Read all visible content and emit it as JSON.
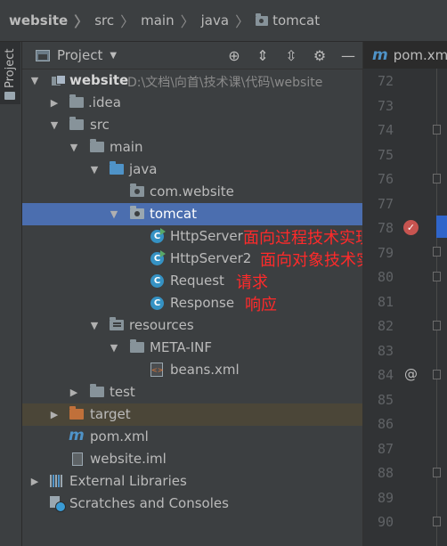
{
  "breadcrumb": {
    "items": [
      "website",
      "src",
      "main",
      "java",
      "tomcat"
    ]
  },
  "tool_strip": {
    "label": "Project"
  },
  "panel": {
    "title": "Project",
    "tools": [
      "target-icon",
      "expand-all-icon",
      "collapse-all-icon",
      "gear-icon",
      "minimize-icon"
    ]
  },
  "tree": {
    "website": {
      "label": "website",
      "path": "D:\\文档\\向首\\技术课\\代码\\website"
    },
    "idea": "idea",
    "src": "src",
    "main": "main",
    "java": "java",
    "com_website": "com.website",
    "tomcat": "tomcat",
    "http_server": "HttpServer",
    "http_server2": "HttpServer2",
    "request": "Request",
    "response": "Response",
    "resources": "resources",
    "meta_inf": "META-INF",
    "beans_xml": "beans.xml",
    "test": "test",
    "target": "target",
    "pom_xml": "pom.xml",
    "website_iml": "website.iml",
    "external_libraries": "External Libraries",
    "scratches": "Scratches and Consoles"
  },
  "annotations": {
    "http_server": "面向过程技术实现",
    "http_server2": "面向对象技术实现",
    "request": "请求",
    "response": "响应"
  },
  "editor": {
    "tab_label": "pom.xm",
    "line_numbers": [
      "72",
      "73",
      "74",
      "75",
      "76",
      "77",
      "78",
      "79",
      "80",
      "81",
      "82",
      "83",
      "84",
      "85",
      "86",
      "87",
      "88",
      "89",
      "90"
    ],
    "gutter_at": "@"
  },
  "colors": {
    "selection": "#4b6eaf",
    "excluded": "#4b4638",
    "annotation": "#ff2a2a",
    "package_folder": "#87939a",
    "source_folder": "#4f93c8",
    "target_folder": "#c0703a"
  }
}
